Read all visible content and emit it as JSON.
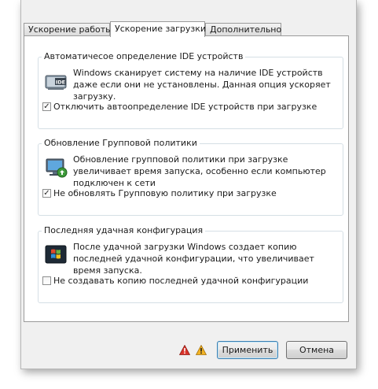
{
  "tabs": [
    {
      "label": "Ускорение работы",
      "active": false
    },
    {
      "label": "Ускорение загрузки",
      "active": true
    },
    {
      "label": "Дополнительно",
      "active": false
    }
  ],
  "groups": [
    {
      "title": "Автоматичесое определение IDE устройств",
      "description": "Windows сканирует систему на наличие IDE устройств даже если они не установлены. Данная опция ускоряет загрузку.",
      "icon": "ide-drive-icon",
      "icon_text": "IDE",
      "checkbox_label": "Отключить автоопределение IDE устройств при загрузке",
      "checked": true
    },
    {
      "title": "Обновление Групповой политики",
      "description": "Обновление групповой политики при загрузке увеличивает время запуска, особенно если компьютер подключен к сети",
      "icon": "group-policy-icon",
      "checkbox_label": "Не обновлять Групповую политику при загрузке",
      "checked": true
    },
    {
      "title": "Последняя удачная конфигурация",
      "description": "После удачной загрузки Windows создает копию последней удачной конфигурации, что увеличивает время запуска.",
      "icon": "windows-logo-icon",
      "checkbox_label": "Не создавать копию последней удачной конфигурации",
      "checked": false
    }
  ],
  "footer": {
    "warning_icons": [
      "red-warning-icon",
      "yellow-warning-icon"
    ],
    "apply_label": "Применить",
    "cancel_label": "Отмена"
  },
  "colors": {
    "warning_red": "#d9332a",
    "warning_yellow": "#f2b324",
    "primary_border": "#3c7fb1"
  }
}
